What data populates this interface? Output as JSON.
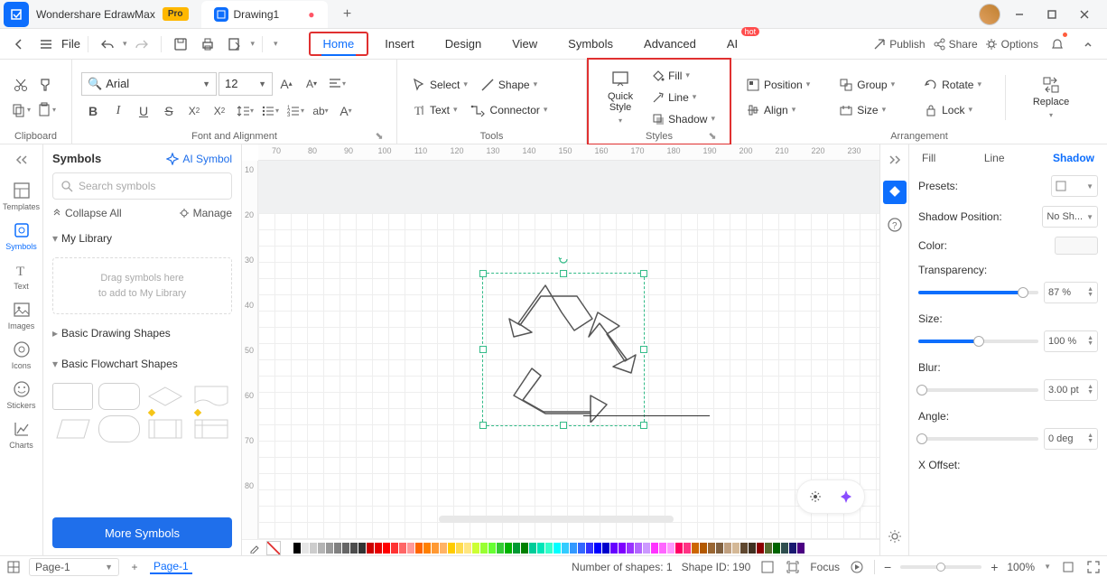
{
  "app": {
    "name": "Wondershare EdrawMax",
    "badge": "Pro",
    "doc_tab": "Drawing1"
  },
  "menubar": {
    "file": "File",
    "tabs": [
      "Home",
      "Insert",
      "Design",
      "View",
      "Symbols",
      "Advanced",
      "AI"
    ],
    "hot": "hot",
    "publish": "Publish",
    "share": "Share",
    "options": "Options"
  },
  "ribbon": {
    "clipboard": "Clipboard",
    "font_alignment": "Font and Alignment",
    "font_name": "Arial",
    "font_size": "12",
    "tools": "Tools",
    "select": "Select",
    "shape": "Shape",
    "text": "Text",
    "connector": "Connector",
    "styles": "Styles",
    "quick_style": "Quick\nStyle",
    "fill": "Fill",
    "line": "Line",
    "shadow": "Shadow",
    "arrangement": "Arrangement",
    "position": "Position",
    "group": "Group",
    "rotate": "Rotate",
    "align": "Align",
    "size": "Size",
    "lock": "Lock",
    "replace": "Replace"
  },
  "leftrail": {
    "items": [
      "Templates",
      "Symbols",
      "Text",
      "Images",
      "Icons",
      "Stickers",
      "Charts"
    ]
  },
  "sidepanel": {
    "title": "Symbols",
    "ai": "AI Symbol",
    "search_ph": "Search symbols",
    "collapse": "Collapse All",
    "manage": "Manage",
    "mylib": "My Library",
    "drop1": "Drag symbols here",
    "drop2": "to add to My Library",
    "basic_drawing": "Basic Drawing Shapes",
    "basic_flow": "Basic Flowchart Shapes",
    "more": "More Symbols"
  },
  "props": {
    "tabs": [
      "Fill",
      "Line",
      "Shadow"
    ],
    "presets": "Presets:",
    "shadow_pos": "Shadow Position:",
    "shadow_pos_val": "No Sh...",
    "color": "Color:",
    "transparency": "Transparency:",
    "transparency_val": "87 %",
    "size": "Size:",
    "size_val": "100 %",
    "blur": "Blur:",
    "blur_val": "3.00 pt",
    "angle": "Angle:",
    "angle_val": "0 deg",
    "xoffset": "X Offset:"
  },
  "statusbar": {
    "page_sel": "Page-1",
    "page_tab": "Page-1",
    "shapes": "Number of shapes: 1",
    "shape_id": "Shape ID: 190",
    "focus": "Focus",
    "zoom": "100%"
  },
  "ruler_h": [
    "70",
    "80",
    "90",
    "100",
    "110",
    "120",
    "130",
    "140",
    "150",
    "160",
    "170",
    "180",
    "190",
    "200",
    "210",
    "220",
    "230"
  ],
  "ruler_v": [
    "10",
    "20",
    "30",
    "40",
    "50",
    "60",
    "70",
    "80"
  ],
  "swatches": [
    "#ffffff",
    "#000000",
    "#e6e6e6",
    "#cccccc",
    "#b3b3b3",
    "#999999",
    "#808080",
    "#666666",
    "#4d4d4d",
    "#333333",
    "#cc0000",
    "#e60000",
    "#ff0000",
    "#ff3333",
    "#ff6666",
    "#ff9999",
    "#ff6600",
    "#ff8000",
    "#ff9933",
    "#ffb366",
    "#ffcc00",
    "#ffdb4d",
    "#ffe680",
    "#ccff33",
    "#99ff33",
    "#66ff33",
    "#33cc33",
    "#00b300",
    "#009933",
    "#008000",
    "#00cc99",
    "#00e6b8",
    "#33ffcc",
    "#00ffff",
    "#33ccff",
    "#3399ff",
    "#3366ff",
    "#3333ff",
    "#0000ff",
    "#0000cc",
    "#6600ff",
    "#7f00ff",
    "#9933ff",
    "#b366ff",
    "#cc99ff",
    "#ff33ff",
    "#ff66ff",
    "#ff99ff",
    "#ff0066",
    "#ff3385",
    "#cc6600",
    "#b35900",
    "#996633",
    "#806040",
    "#c0a080",
    "#d4b896",
    "#604830",
    "#403020",
    "#8b0000",
    "#556b2f",
    "#006400",
    "#2f4f4f",
    "#191970",
    "#4b0082"
  ]
}
